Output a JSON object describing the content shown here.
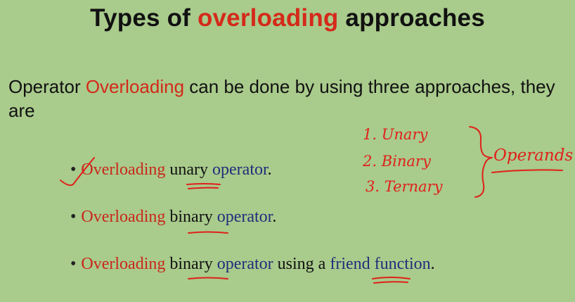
{
  "slide": {
    "title": {
      "part1": "Types of ",
      "accent": "overloading",
      "part2": " approaches"
    },
    "intro": {
      "part1": "Operator ",
      "accent": "Overloading",
      "part2": " can be done by using three approaches, they are"
    },
    "bullets": [
      {
        "red": "Overloading",
        "black": "unary",
        "blue": "operator",
        "tail": "."
      },
      {
        "red": "Overloading",
        "black": "binary",
        "blue": "operator",
        "tail": "."
      },
      {
        "red": "Overloading",
        "black": "binary",
        "blue": "operator",
        "mid": " using a ",
        "blue2": "friend",
        "blue3": "function",
        "tail": "."
      }
    ],
    "bullet_symbol": "•",
    "annotations": {
      "list": [
        "1. Unary",
        "2. Binary",
        "3. Ternary"
      ],
      "label": "Operands",
      "ink_color": "#e0201a"
    }
  }
}
